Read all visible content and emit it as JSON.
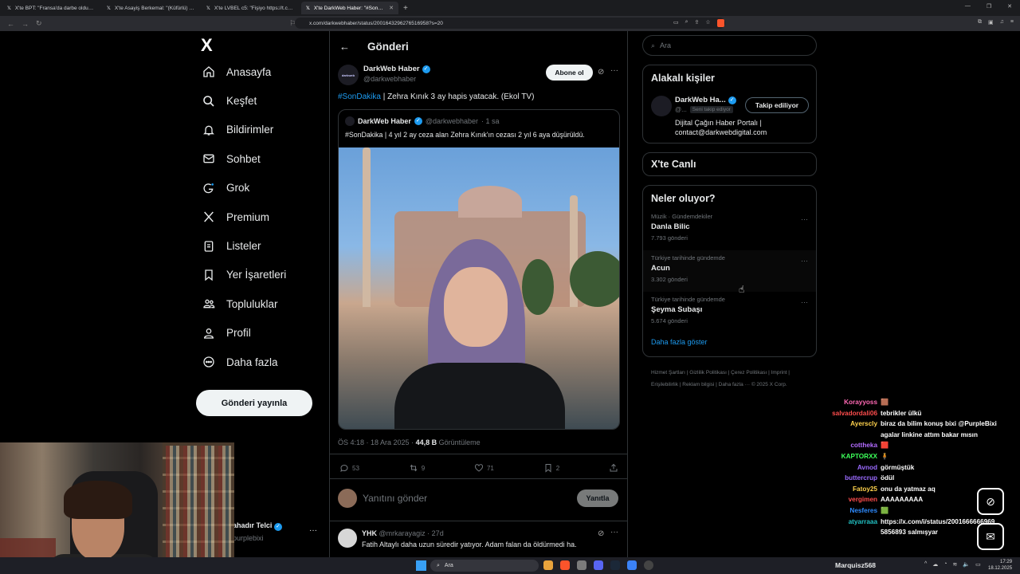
{
  "browser": {
    "tabs": [
      {
        "label": "X'te BPT: \"Fransa'da darbe olduğunu"
      },
      {
        "label": "X'te Asayiş Berkemal: \"(Küfürlü) İstanb"
      },
      {
        "label": "X'te LVBEL c5: \"Fişiyo https://t.co/A1"
      },
      {
        "label": "X'te DarkWeb Haber: \"#SonDaik"
      }
    ],
    "new_tab": "+",
    "address": "x.com/darkwebhaber/status/2001643296276516958?s=20"
  },
  "nav": {
    "logo": "X",
    "items": [
      {
        "label": "Anasayfa",
        "icon": "home-icon"
      },
      {
        "label": "Keşfet",
        "icon": "search-icon"
      },
      {
        "label": "Bildirimler",
        "icon": "bell-icon"
      },
      {
        "label": "Sohbet",
        "icon": "mail-icon"
      },
      {
        "label": "Grok",
        "icon": "grok-icon"
      },
      {
        "label": "Premium",
        "icon": "x-premium-icon"
      },
      {
        "label": "Listeler",
        "icon": "list-icon"
      },
      {
        "label": "Yer İşaretleri",
        "icon": "bookmark-icon"
      },
      {
        "label": "Topluluklar",
        "icon": "communities-icon"
      },
      {
        "label": "Profil",
        "icon": "profile-icon"
      },
      {
        "label": "Daha fazla",
        "icon": "more-circle-icon"
      }
    ],
    "post_button": "Gönderi yayınla",
    "account": {
      "name": "ahadır Telci",
      "handle": "purplebixi",
      "more": "···"
    }
  },
  "post": {
    "header_title": "Gönderi",
    "author_name": "DarkWeb Haber",
    "author_handle": "@darkwebhaber",
    "avatar_text": "darkweb",
    "subscribe": "Abone ol",
    "text_hashtag": "#SonDakika",
    "text_body": " | Zehra Kınık 3 ay hapis yatacak. (Ekol TV)",
    "quote": {
      "author_name": "DarkWeb Haber",
      "author_handle": "@darkwebhaber",
      "time": "· 1 sa",
      "text": "#SonDakika | 4 yıl 2 ay ceza alan Zehra Kınık'ın cezası 2 yıl 6 aya düşürüldü."
    },
    "timestamp": "ÖS 4:18 · 18 Ara 2025 · ",
    "views": "44,8 B",
    "views_label": " Görüntüleme",
    "stats": {
      "replies": "53",
      "reposts": "9",
      "likes": "71",
      "bookmarks": "2"
    },
    "reply_placeholder": "Yanıtını gönder",
    "reply_button": "Yanıtla",
    "comment": {
      "name": "YHK",
      "handle": "@mrkarayagiz · 27d",
      "text": "Fatih Altaylı daha uzun süredir yatıyor. Adam falan da öldürmedi ha."
    }
  },
  "right": {
    "search_placeholder": "Ara",
    "related_title": "Alakalı kişiler",
    "related": {
      "name": "DarkWeb Ha...",
      "handle": "@...",
      "follows_you": "Seni takip ediyor",
      "button": "Takip ediliyor",
      "bio": "Dijital Çağın Haber Portalı | contact@darkwebdigital.com"
    },
    "live_title": "X'te Canlı",
    "trends_title": "Neler oluyor?",
    "trends": [
      {
        "category": "Müzik · Gündemdekiler",
        "name": "Danla Bilic",
        "count": "7.793 gönderi"
      },
      {
        "category": "Türkiye tarihinde gündemde",
        "name": "Acun",
        "count": "3.302 gönderi"
      },
      {
        "category": "Türkiye tarihinde gündemde",
        "name": "Şeyma Subaşı",
        "count": "5.674 gönderi"
      }
    ],
    "show_more": "Daha fazla göster",
    "footer": "Hizmet Şartları  |  Gizlilik Politikası  |  Çerez Politikası  |  Imprint  |  Erişilebilirlik  |  Reklam bilgisi  |  Daha fazla ···  © 2025 X Corp."
  },
  "chat": [
    {
      "user": "Korayyoss",
      "color": "#ff69b4",
      "msg": "🟫"
    },
    {
      "user": "salvadordali06",
      "color": "#ff4d4d",
      "msg": "tebrikler ülkü"
    },
    {
      "user": "Ayerscly",
      "color": "#ffd24d",
      "msg": "biraz da bilim konuş bixi @PurpleBixi"
    },
    {
      "user": "",
      "color": "#ffffff",
      "msg": "agalar linkine attım bakar mısın"
    },
    {
      "user": "cottheka",
      "color": "#b36bff",
      "msg": "🟥"
    },
    {
      "user": "KAPTORXX",
      "color": "#3dff5a",
      "msg": "🧍"
    },
    {
      "user": "Avnod",
      "color": "#9b6bff",
      "msg": "görmüştük"
    },
    {
      "user": "buttercrup",
      "color": "#9b6bff",
      "msg": "ödül"
    },
    {
      "user": "Fatoy25",
      "color": "#ffd24d",
      "msg": "onu da yatmaz aq"
    },
    {
      "user": "vergimen",
      "color": "#ff4d4d",
      "msg": "AAAAAAAAA"
    },
    {
      "user": "Nesferes",
      "color": "#2e8bff",
      "msg": "🟩"
    },
    {
      "user": "atyarraaa",
      "color": "#22c1c3",
      "msg": "https://x.com/i/status/2001666666969"
    },
    {
      "user": "",
      "color": "#ffffff",
      "msg": "5856893 salmışyar"
    }
  ],
  "taskbar": {
    "search": "Ara",
    "user": "Marquisz568",
    "time": "17:29",
    "date": "18.12.2025"
  }
}
